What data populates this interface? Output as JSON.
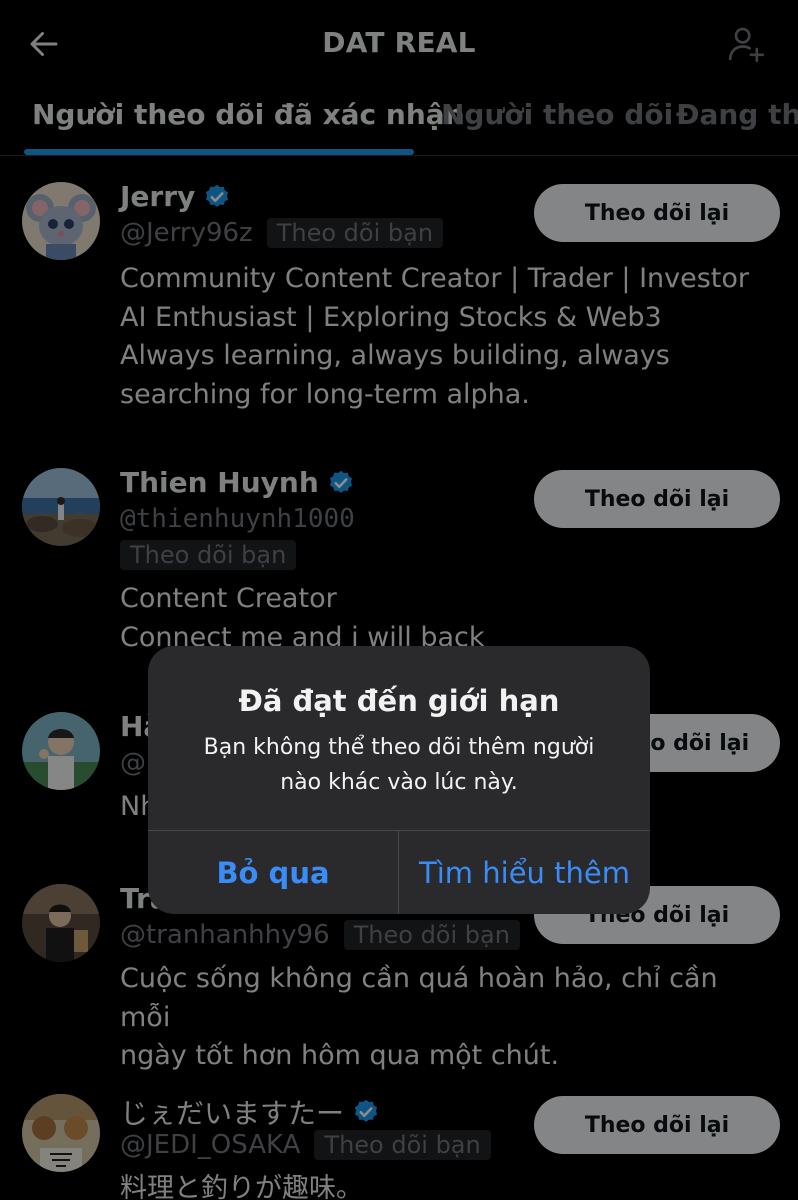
{
  "header": {
    "title": "DAT REAL",
    "back_icon": "arrow-left-icon",
    "add_user_icon": "add-user-icon"
  },
  "tabs": [
    {
      "label": "Người theo dõi đã xác nhận",
      "active": true
    },
    {
      "label": "Người theo dõi",
      "active": false
    },
    {
      "label": "Đang theo dõi",
      "active": false
    }
  ],
  "colors": {
    "accent": "#1d9bf0",
    "button_bg": "#eff3f4",
    "alert_bg": "#2a2a2c",
    "alert_button_text": "#3a8cf7"
  },
  "users": [
    {
      "name": "Jerry",
      "handle": "@Jerry96z",
      "badge": "Theo dõi bạn",
      "button": "Theo dõi lại",
      "bio": [
        "Community Content Creator | Trader | Investor",
        "AI Enthusiast | Exploring Stocks & Web3",
        "Always learning, always building, always",
        "searching for long-term alpha."
      ]
    },
    {
      "name": "Thien Huynh",
      "handle": "@thienhuynh1000",
      "badge": "Theo dõi bạn",
      "button": "Theo dõi lại",
      "bio": [
        "Content Creator",
        "Connect me and i will back"
      ]
    },
    {
      "name": "Hà",
      "handle": "@",
      "badge": "",
      "button": "Theo dõi lại",
      "bio": [
        "Nh"
      ]
    },
    {
      "name": "Tra",
      "handle": "@tranhanhhy96",
      "badge": "Theo dõi bạn",
      "button": "Theo dõi lại",
      "bio": [
        "Cuộc sống không cần quá hoàn hảo, chỉ cần mỗi",
        "ngày tốt hơn hôm qua một chút."
      ]
    },
    {
      "name": "じぇだいますたー",
      "handle": "@JEDI_OSAKA",
      "badge": "Theo dõi bạn",
      "button": "Theo dõi lại",
      "bio": [
        "料理と釣りが趣味。"
      ]
    }
  ],
  "alert": {
    "title": "Đã đạt đến giới hạn",
    "message_line1": "Bạn không thể theo dõi thêm người",
    "message_line2": "nào khác vào lúc này.",
    "dismiss": "Bỏ qua",
    "learn_more": "Tìm hiểu thêm"
  }
}
